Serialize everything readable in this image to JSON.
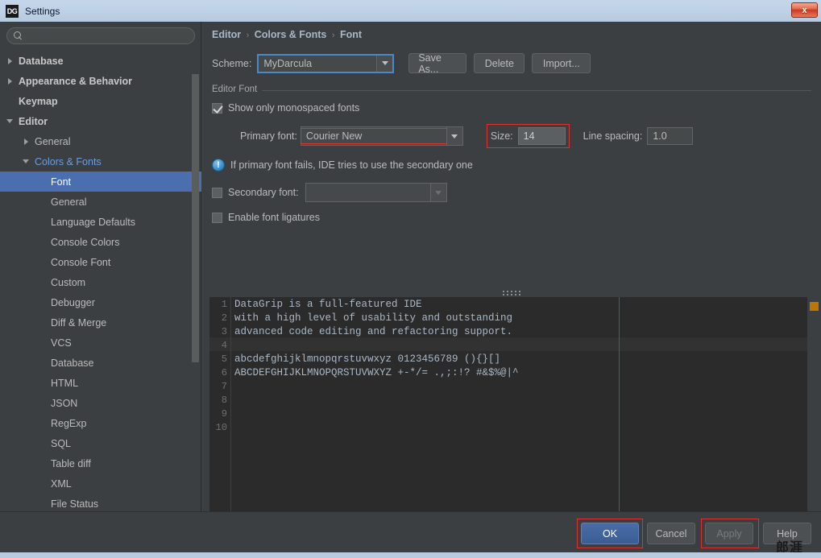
{
  "window": {
    "title": "Settings",
    "app_icon": "datagrip-icon",
    "app_icon_text": "DG",
    "close_label": "x"
  },
  "sidebar": {
    "search": {
      "value": "",
      "placeholder": "",
      "icon": "search-icon"
    },
    "items": [
      {
        "label": "Database",
        "indent": 0,
        "arrow": "right",
        "style": "bold"
      },
      {
        "label": "Appearance & Behavior",
        "indent": 0,
        "arrow": "right",
        "style": "bold"
      },
      {
        "label": "Keymap",
        "indent": 0,
        "arrow": "none",
        "style": "bold"
      },
      {
        "label": "Editor",
        "indent": 0,
        "arrow": "down",
        "style": "bold"
      },
      {
        "label": "General",
        "indent": 1,
        "arrow": "right",
        "style": "normal"
      },
      {
        "label": "Colors & Fonts",
        "indent": 1,
        "arrow": "down",
        "style": "accent"
      },
      {
        "label": "Font",
        "indent": 2,
        "arrow": "none",
        "style": "selected"
      },
      {
        "label": "General",
        "indent": 2,
        "arrow": "none",
        "style": "normal"
      },
      {
        "label": "Language Defaults",
        "indent": 2,
        "arrow": "none",
        "style": "normal"
      },
      {
        "label": "Console Colors",
        "indent": 2,
        "arrow": "none",
        "style": "normal"
      },
      {
        "label": "Console Font",
        "indent": 2,
        "arrow": "none",
        "style": "normal"
      },
      {
        "label": "Custom",
        "indent": 2,
        "arrow": "none",
        "style": "normal"
      },
      {
        "label": "Debugger",
        "indent": 2,
        "arrow": "none",
        "style": "normal"
      },
      {
        "label": "Diff & Merge",
        "indent": 2,
        "arrow": "none",
        "style": "normal"
      },
      {
        "label": "VCS",
        "indent": 2,
        "arrow": "none",
        "style": "normal"
      },
      {
        "label": "Database",
        "indent": 2,
        "arrow": "none",
        "style": "normal"
      },
      {
        "label": "HTML",
        "indent": 2,
        "arrow": "none",
        "style": "normal"
      },
      {
        "label": "JSON",
        "indent": 2,
        "arrow": "none",
        "style": "normal"
      },
      {
        "label": "RegExp",
        "indent": 2,
        "arrow": "none",
        "style": "normal"
      },
      {
        "label": "SQL",
        "indent": 2,
        "arrow": "none",
        "style": "normal"
      },
      {
        "label": "Table diff",
        "indent": 2,
        "arrow": "none",
        "style": "normal"
      },
      {
        "label": "XML",
        "indent": 2,
        "arrow": "none",
        "style": "normal"
      },
      {
        "label": "File Status",
        "indent": 2,
        "arrow": "none",
        "style": "normal"
      }
    ]
  },
  "breadcrumb": {
    "parts": [
      "Editor",
      "Colors & Fonts",
      "Font"
    ],
    "separator": "›"
  },
  "scheme": {
    "label": "Scheme:",
    "value": "MyDarcula",
    "save_as_label": "Save As...",
    "delete_label": "Delete",
    "import_label": "Import..."
  },
  "editor_font": {
    "group_title": "Editor Font",
    "show_monospaced": {
      "label": "Show only monospaced fonts",
      "checked": true
    },
    "primary_font": {
      "label": "Primary font:",
      "value": "Courier New",
      "highlighted": true
    },
    "size": {
      "label": "Size:",
      "value": "14",
      "highlighted": true
    },
    "line_spacing": {
      "label": "Line spacing:",
      "value": "1.0"
    },
    "info_message": "If primary font fails, IDE tries to use the secondary one",
    "secondary_font": {
      "label": "Secondary font:",
      "value": "",
      "checked": false
    },
    "ligatures": {
      "label": "Enable font ligatures",
      "checked": false
    }
  },
  "preview": {
    "lines": [
      {
        "num": "1",
        "text": "DataGrip is a full-featured IDE"
      },
      {
        "num": "2",
        "text": "with a high level of usability and outstanding"
      },
      {
        "num": "3",
        "text": "advanced code editing and refactoring support."
      },
      {
        "num": "4",
        "text": ""
      },
      {
        "num": "5",
        "text": "abcdefghijklmnopqrstuvwxyz 0123456789 (){}[]"
      },
      {
        "num": "6",
        "text": "ABCDEFGHIJKLMNOPQRSTUVWXYZ +-*/= .,;:!? #&$%@|^"
      },
      {
        "num": "7",
        "text": ""
      },
      {
        "num": "8",
        "text": ""
      },
      {
        "num": "9",
        "text": ""
      },
      {
        "num": "10",
        "text": ""
      }
    ],
    "marker_color": "#bf7503"
  },
  "buttons": {
    "ok": "OK",
    "cancel": "Cancel",
    "apply": "Apply",
    "help": "Help"
  },
  "watermark": "郎涯",
  "colors": {
    "background": "#3c3f41",
    "selection": "#4b6eaf",
    "editor_bg": "#2b2b2b",
    "accent_link": "#6c9ce0",
    "highlight_red": "#e03030",
    "marker_orange": "#bf7503"
  }
}
